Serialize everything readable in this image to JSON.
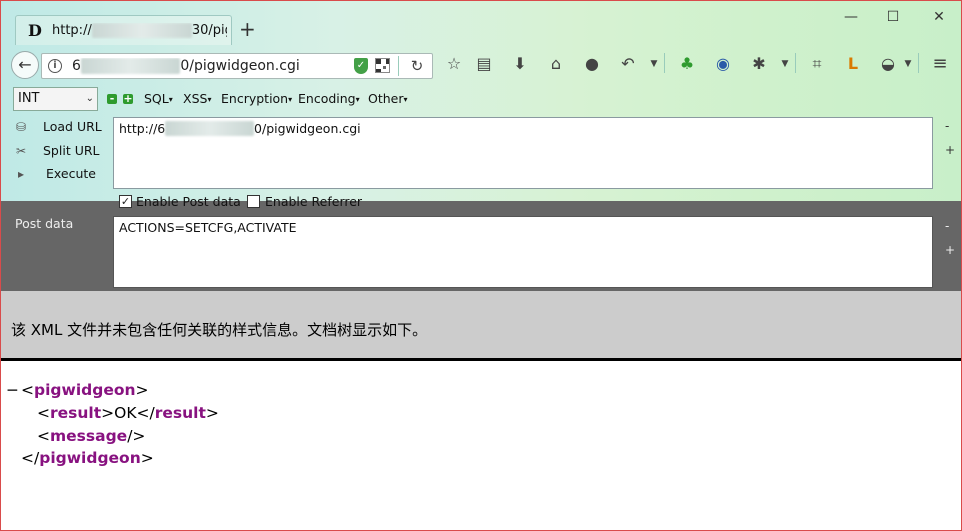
{
  "tab": {
    "favicon": "D",
    "title_prefix": "http://",
    "title_redacted": "xxxxxxxxxxxxx",
    "title_suffix": "30/pig",
    "new_tab": "+"
  },
  "window_controls": {
    "minimize": "—",
    "maximize": "☐",
    "close": "✕"
  },
  "navbar": {
    "back": "←",
    "url_prefix": "6",
    "url_redacted": "xxxxxxxxxxxx",
    "url_suffix": "0/pigwidgeon.cgi",
    "reload": "↻",
    "icons": [
      "star-icon",
      "reader-icon",
      "download-icon",
      "home-icon",
      "chat-icon",
      "undo-icon",
      "frog-icon",
      "globe-icon",
      "bug-icon",
      "crop-icon",
      "l-icon",
      "mask-icon",
      "menu-icon"
    ]
  },
  "hackbar": {
    "select_value": "INT",
    "menus": [
      "SQL",
      "XSS",
      "Encryption",
      "Encoding",
      "Other"
    ],
    "actions": [
      "Load URL",
      "Split URL",
      "Execute"
    ],
    "url_prefix": "http://6",
    "url_redacted": "xxxxxxxxxxxx",
    "url_suffix": "0/pigwidgeon.cgi",
    "enable_post": "Enable Post data",
    "enable_referrer": "Enable Referrer",
    "post_label": "Post data",
    "post_value": "ACTIONS=SETCFG,ACTIVATE",
    "minus": "-",
    "plus": "+"
  },
  "xml_info": "该 XML 文件并未包含任何关联的样式信息。文档树显示如下。",
  "xml": {
    "collapse": "−",
    "root_tag": "pigwidgeon",
    "result_tag": "result",
    "result_value": "OK",
    "message_tag": "message"
  }
}
